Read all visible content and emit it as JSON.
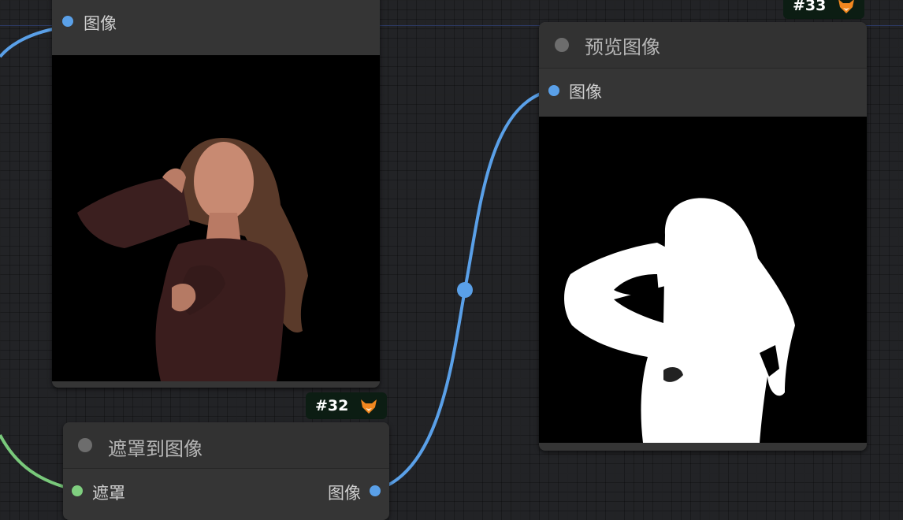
{
  "colors": {
    "image_slot": "#5aa0e8",
    "mask_slot": "#7fcf7f",
    "image_link": "#5aa0e8",
    "mask_link": "#79c97b",
    "badge_bg": "#0c1d13"
  },
  "load_node": {
    "output_label": "图像"
  },
  "badge_32": {
    "text": "#32",
    "icon": "fox-icon"
  },
  "badge_33": {
    "text": "#33",
    "icon": "fox-icon"
  },
  "mask_to_image_node": {
    "title": "遮罩到图像",
    "input_label": "遮罩",
    "output_label": "图像"
  },
  "preview_node": {
    "title": "预览图像",
    "input_label": "图像"
  }
}
